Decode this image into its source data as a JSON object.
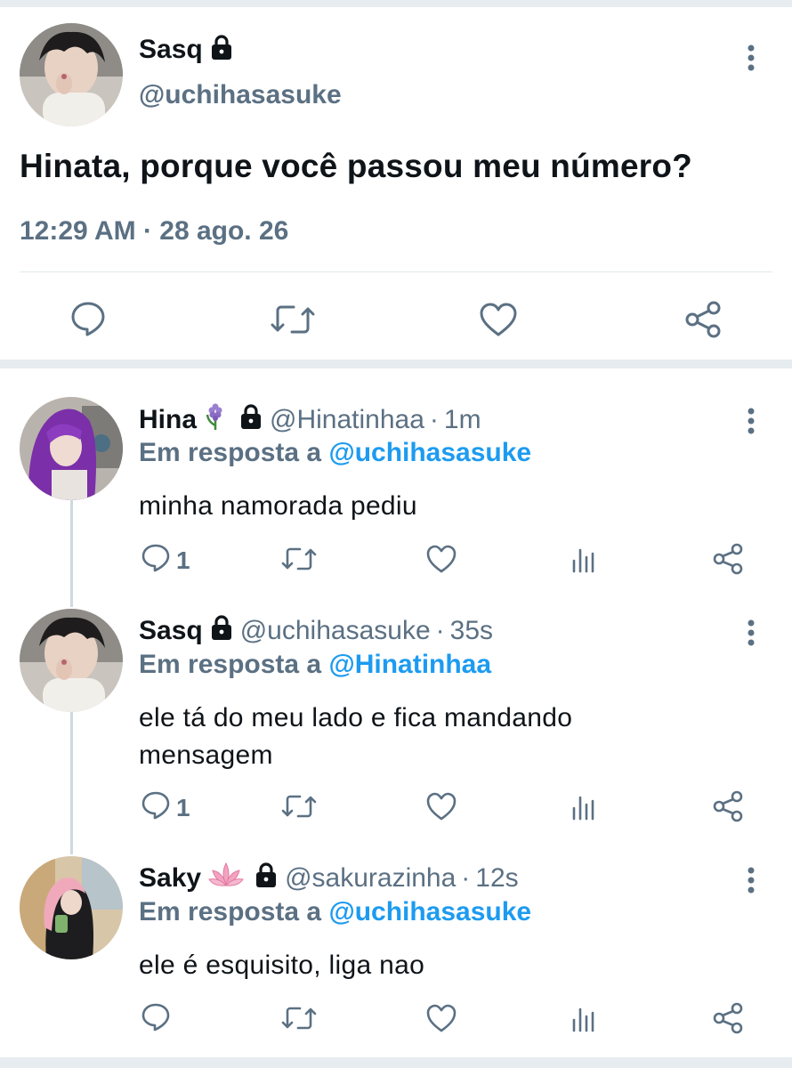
{
  "main_tweet": {
    "display_name": "Sasq",
    "handle": "@uchihasasuke",
    "text": "Hinata, porque você passou meu número?",
    "timestamp": "12:29 AM · 28 ago. 26",
    "icons": [
      "lock-icon",
      "more-icon",
      "reply-icon",
      "retweet-icon",
      "like-icon",
      "share-icon"
    ]
  },
  "replies": [
    {
      "display_name": "Hina",
      "emoji": "🪻",
      "handle": "@Hinatinhaa",
      "separator": "·",
      "time": "1m",
      "reply_prefix": "Em resposta a",
      "reply_to": "@uchihasasuke",
      "text": "minha namorada pediu",
      "reply_count": "1"
    },
    {
      "display_name": "Sasq",
      "emoji": "",
      "handle": "@uchihasasuke",
      "separator": "·",
      "time": "35s",
      "reply_prefix": "Em resposta a",
      "reply_to": "@Hinatinhaa",
      "text": "ele tá do meu lado e fica mandando mensagem",
      "reply_count": "1"
    },
    {
      "display_name": "Saky",
      "emoji": "🪷",
      "handle": "@sakurazinha",
      "separator": "·",
      "time": "12s",
      "reply_prefix": "Em resposta a",
      "reply_to": "@uchihasasuke",
      "text": "ele é esquisito, liga nao",
      "reply_count": ""
    }
  ],
  "colors": {
    "text_primary": "#0f1419",
    "text_secondary": "#5b7083",
    "link": "#1d9bf0",
    "divider": "#e6ecf0"
  }
}
